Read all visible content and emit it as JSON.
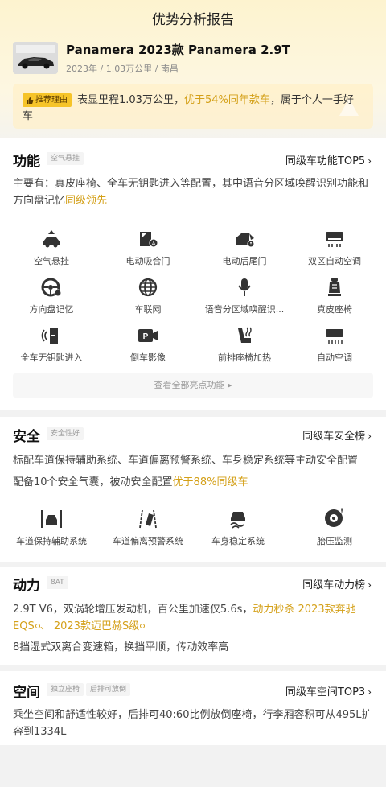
{
  "header": {
    "title": "优势分析报告"
  },
  "car": {
    "name": "Panamera 2023款 Panamera 2.9T",
    "meta": "2023年 / 1.03万公里 / 南昌"
  },
  "reason": {
    "tag": "推荐理由",
    "text_pre": "表显里程1.03万公里，",
    "text_hl": "优于54%同年款车",
    "text_post": "，属于个人一手好车"
  },
  "function": {
    "title": "功能",
    "tag": "空气悬挂",
    "link": "同级车功能TOP5",
    "desc_pre": "主要有：真皮座椅、全车无钥匙进入等配置，其中语音分区域唤醒识别功能和方向盘记忆",
    "desc_hl": "同级领先",
    "features": [
      {
        "label": "空气悬挂",
        "icon": "air-suspension-icon"
      },
      {
        "label": "电动吸合门",
        "icon": "soft-close-door-icon"
      },
      {
        "label": "电动后尾门",
        "icon": "power-tailgate-icon"
      },
      {
        "label": "双区自动空调",
        "icon": "dual-zone-ac-icon"
      },
      {
        "label": "方向盘记忆",
        "icon": "steering-memory-icon"
      },
      {
        "label": "车联网",
        "icon": "connected-car-icon"
      },
      {
        "label": "语音分区域唤醒识...",
        "icon": "voice-zone-icon"
      },
      {
        "label": "真皮座椅",
        "icon": "leather-seat-icon"
      },
      {
        "label": "全车无钥匙进入",
        "icon": "keyless-entry-icon"
      },
      {
        "label": "倒车影像",
        "icon": "reverse-camera-icon"
      },
      {
        "label": "前排座椅加热",
        "icon": "seat-heating-icon"
      },
      {
        "label": "自动空调",
        "icon": "auto-ac-icon"
      }
    ],
    "view_all": "查看全部亮点功能"
  },
  "safety": {
    "title": "安全",
    "tag": "安全性好",
    "link": "同级车安全榜",
    "desc1": "标配车道保持辅助系统、车道偏离预警系统、车身稳定系统等主动安全配置",
    "desc2_pre": "配备10个安全气囊，被动安全配置",
    "desc2_hl": "优于88%同级车",
    "features": [
      {
        "label": "车道保持辅助系统",
        "icon": "lane-keep-icon"
      },
      {
        "label": "车道偏离预警系统",
        "icon": "lane-departure-icon"
      },
      {
        "label": "车身稳定系统",
        "icon": "stability-control-icon"
      },
      {
        "label": "胎压监测",
        "icon": "tire-pressure-icon"
      }
    ]
  },
  "power": {
    "title": "动力",
    "tag": "8AT",
    "link": "同级车动力榜",
    "desc1_pre": "2.9T V6，双涡轮增压发动机，百公里加速仅5.6s，",
    "desc1_hl1": "动力秒杀",
    "desc1_hl2": "2023款奔驰EQS",
    "desc1_sep": "、",
    "desc1_hl3": "2023款迈巴赫S级",
    "desc2": "8挡湿式双离合变速箱，换挡平顺，传动效率高"
  },
  "space": {
    "title": "空间",
    "tag1": "独立座椅",
    "tag2": "后排可放倒",
    "link": "同级车空间TOP3",
    "desc": "乘坐空间和舒适性较好，后排可40:60比例放倒座椅，行李厢容积可从495L扩容到1334L"
  },
  "colors": {
    "accent": "#d4a018",
    "tag_bg": "#f6c429"
  }
}
